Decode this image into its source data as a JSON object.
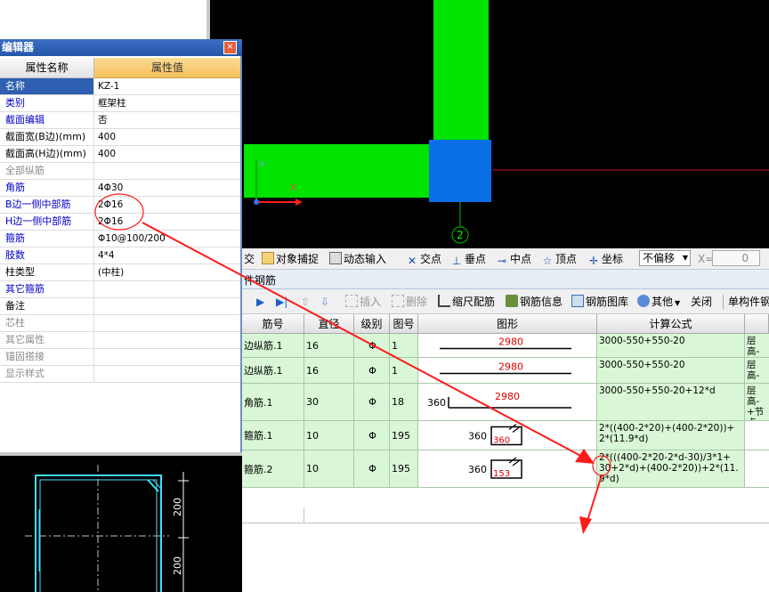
{
  "property_editor": {
    "title": "编辑器",
    "close_symbol": "×",
    "col_name": "属性名称",
    "col_value": "属性值",
    "rows": [
      {
        "name": "名称",
        "value": "KZ-1",
        "style": "sel"
      },
      {
        "name": "类别",
        "value": "框架柱",
        "style": "blue"
      },
      {
        "name": "截面编辑",
        "value": "否",
        "style": "blue"
      },
      {
        "name": "截面宽(B边)(mm)",
        "value": "400",
        "style": "black"
      },
      {
        "name": "截面高(H边)(mm)",
        "value": "400",
        "style": "black"
      },
      {
        "name": "全部纵筋",
        "value": "",
        "style": "gray"
      },
      {
        "name": "角筋",
        "value": "4Φ30",
        "style": "blue"
      },
      {
        "name": "B边一侧中部筋",
        "value": "2Φ16",
        "style": "blue"
      },
      {
        "name": "H边一侧中部筋",
        "value": "2Φ16",
        "style": "blue"
      },
      {
        "name": "箍筋",
        "value": "Φ10@100/200",
        "style": "blue"
      },
      {
        "name": "肢数",
        "value": "4*4",
        "style": "blue"
      },
      {
        "name": "柱类型",
        "value": "(中柱)",
        "style": "black"
      },
      {
        "name": "其它箍筋",
        "value": "",
        "style": "blue"
      },
      {
        "name": "备注",
        "value": "",
        "style": "black"
      },
      {
        "name": "芯柱",
        "value": "",
        "style": "gray"
      },
      {
        "name": "其它属性",
        "value": "",
        "style": "gray"
      },
      {
        "name": "锚固搭接",
        "value": "",
        "style": "gray"
      },
      {
        "name": "显示样式",
        "value": "",
        "style": "gray"
      }
    ]
  },
  "cad_top": {
    "axis_label": "2"
  },
  "cad_bottom": {
    "dim1": "200",
    "dim2": "200"
  },
  "snap_toolbar": {
    "item_partial": "交",
    "object_snap": "对象捕捉",
    "dynamic_input": "动态输入",
    "intersection": "交点",
    "perpendicular": "垂点",
    "midpoint": "中点",
    "vertex": "顶点",
    "coordinate": "坐标",
    "offset_select": "不偏移",
    "x_label": "X=",
    "x_value": "0"
  },
  "section_title": "件钢筋",
  "rebar_toolbar": {
    "insert": "插入",
    "delete": "删除",
    "scale_rebar": "缩尺配筋",
    "rebar_info": "钢筋信息",
    "rebar_library": "钢筋图库",
    "other": "其他",
    "close": "关闭",
    "single_member": "单构件钢"
  },
  "table": {
    "headers": [
      "筋号",
      "直径(mm)",
      "级别",
      "图号",
      "图形",
      "计算公式",
      ""
    ],
    "rows": [
      {
        "name": "边纵筋.1",
        "dia": "16",
        "grade": "Φ",
        "fig": "1",
        "shape_value": "2980",
        "shape_left": "",
        "shape_type": "straight",
        "formula": "3000-550+550-20",
        "desc": "层高-"
      },
      {
        "name": "边纵筋.1",
        "dia": "16",
        "grade": "Φ",
        "fig": "1",
        "shape_value": "2980",
        "shape_left": "",
        "shape_type": "straight",
        "formula": "3000-550+550-20",
        "desc": "层高-"
      },
      {
        "name": "角筋.1",
        "dia": "30",
        "grade": "Φ",
        "fig": "18",
        "shape_value": "2980",
        "shape_left": "360",
        "shape_type": "hook",
        "formula": "3000-550+550-20+12*d",
        "desc": "层高-\n+节点\n折"
      },
      {
        "name": "箍筋.1",
        "dia": "10",
        "grade": "Φ",
        "fig": "195",
        "shape_value": "360",
        "shape_left": "360",
        "shape_type": "stirrup",
        "formula": "2*((400-2*20)+(400-2*20))+\n2*(11.9*d)",
        "desc": ""
      },
      {
        "name": "箍筋.2",
        "dia": "10",
        "grade": "Φ",
        "fig": "195",
        "shape_value": "153",
        "shape_left": "360",
        "shape_type": "stirrup",
        "formula": "2*(((400-2*20-2*d-30)/3*1+\n30+2*d)+(400-2*20))+2*(11.\n9*d)",
        "desc": ""
      }
    ]
  },
  "colors": {
    "green": "#00e400",
    "blue_block": "#0a6ee6",
    "annotation_red": "#ff1a1a"
  }
}
